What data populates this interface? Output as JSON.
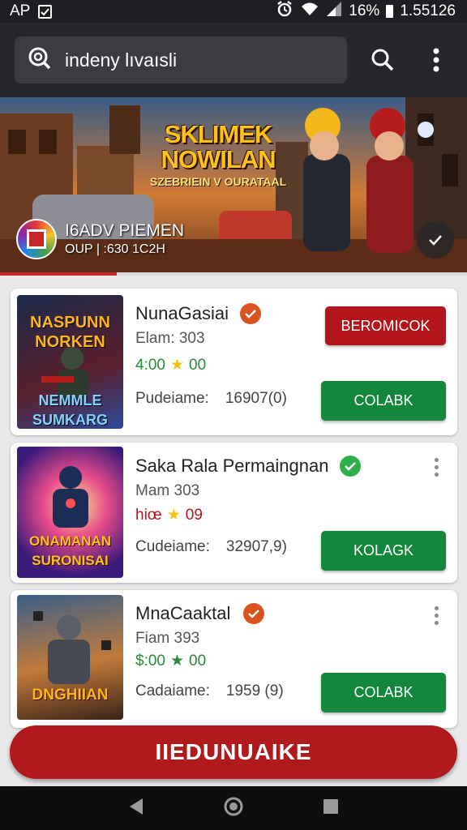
{
  "status_bar": {
    "left_text": "AP",
    "battery": "16%",
    "time": "1.55126"
  },
  "search": {
    "value": "indeny lıvaısli",
    "placeholder": ""
  },
  "banner": {
    "title_line1": "SKLIMEK",
    "title_line2": "NOWILAN",
    "title_line3": "SZEBRIEIN V OURATAAL",
    "channel_name": "I6ADV PIEMEN",
    "channel_sub": "OUP | :630 1C2H",
    "progress": 0.25
  },
  "games": [
    {
      "title": "NunaGasiai",
      "meta": "Elam: 303",
      "rating_num": "4:00",
      "rating_star": "00",
      "size_label": "Pudeiame:",
      "size_value": "16907(0)",
      "primary_button": "BEROMICOK",
      "secondary_button": "COLABK",
      "thumb_line1": "NASPUNN",
      "thumb_line2": "NORKEN",
      "thumb_line3": "NEMMLE",
      "thumb_line4": "SUMKARG"
    },
    {
      "title": "Saka Rala Permaingnan",
      "meta": "Mam 303",
      "rating_num": "hiœ",
      "rating_star": "09",
      "size_label": "Cudeiame:",
      "size_value": "32907,9)",
      "secondary_button": "KOLAGK",
      "thumb_line1": "ONAMANAN",
      "thumb_line2": "SURONISAI"
    },
    {
      "title": "MnaCaaktal",
      "meta": "Fiam 393",
      "rating_num": "$:00",
      "rating_star": "00",
      "size_label": "Cadaiame:",
      "size_value": "1959 (9)",
      "secondary_button": "COLABK",
      "thumb_line1": "DNGHIIAN"
    }
  ],
  "bottom_button": "IIEDUNUAIKE",
  "colors": {
    "accent_red": "#b3151b",
    "accent_green": "#13883d",
    "badge_orange": "#d9531e",
    "badge_green": "#2eaf4a"
  }
}
